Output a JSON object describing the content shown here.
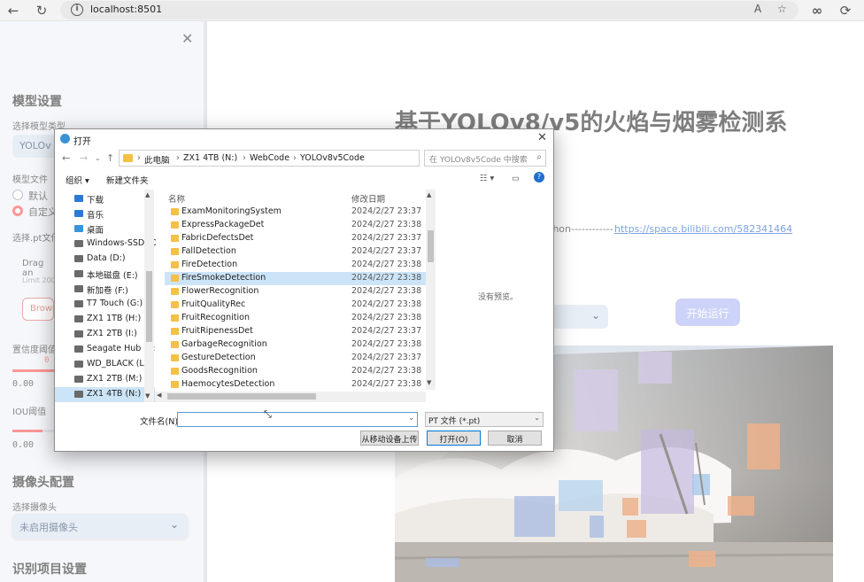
{
  "browser": {
    "url": "localhost:8501",
    "read_aloud_label": "A",
    "icons": [
      "back-arrow-icon",
      "refresh-icon",
      "info-icon",
      "read-aloud-icon",
      "favorite-star-icon",
      "infinity-icon",
      "extensions-icon"
    ]
  },
  "sidebar": {
    "section_model": "模型设置",
    "model_type_label": "选择模型类型",
    "model_type_value": "YOLOv",
    "model_file_label": "模型文件",
    "radio_default": "默认",
    "radio_custom": "自定义",
    "upload_label": "选择.pt文件",
    "upload_drag": "Drag an",
    "upload_limit": "Limit 200",
    "browse_label": "Brows",
    "conf_label": "置信度阈值",
    "conf_value": "0.00",
    "conf_fraction": 0.37,
    "conf_thumb": "0",
    "iou_label": "IOU阈值",
    "iou_value": "0.00",
    "iou_fraction": 0.17,
    "section_camera": "摄像头配置",
    "camera_label": "选择摄像头",
    "camera_value": "未启用摄像头",
    "section_recognition": "识别项目设置"
  },
  "main": {
    "title": "基于YOLOv8/v5的火焰与烟雾检测系",
    "link_prefix": "thon------------",
    "link_text": "https://space.bilibili.com/582341464",
    "run_button": "开始运行"
  },
  "dialog": {
    "title": "打开",
    "breadcrumbs": [
      "此电脑",
      "ZX1 4TB (N:)",
      "WebCode",
      "YOLOv8v5Code"
    ],
    "search_placeholder": "在 YOLOv8v5Code 中搜索",
    "toolbar_organize": "组织 ▾",
    "toolbar_new_folder": "新建文件夹",
    "nav_items": [
      {
        "label": "下载",
        "icon": "download-icon"
      },
      {
        "label": "音乐",
        "icon": "music-icon"
      },
      {
        "label": "桌面",
        "icon": "desktop-icon"
      },
      {
        "label": "Windows-SSD (C",
        "icon": "drive-icon"
      },
      {
        "label": "Data (D:)",
        "icon": "drive-icon"
      },
      {
        "label": "本地磁盘 (E:)",
        "icon": "drive-icon"
      },
      {
        "label": "新加卷 (F:)",
        "icon": "drive-icon"
      },
      {
        "label": "T7 Touch (G:)",
        "icon": "drive-icon"
      },
      {
        "label": "ZX1 1TB (H:)",
        "icon": "drive-icon"
      },
      {
        "label": "ZX1 2TB (I:)",
        "icon": "drive-icon"
      },
      {
        "label": "Seagate Hub (K:",
        "icon": "drive-icon"
      },
      {
        "label": "WD_BLACK (L:)",
        "icon": "drive-icon"
      },
      {
        "label": "ZX1 2TB (M:)",
        "icon": "drive-icon"
      },
      {
        "label": "ZX1 4TB (N:)",
        "icon": "drive-icon",
        "selected": true
      }
    ],
    "col_name": "名称",
    "col_date": "修改日期",
    "files": [
      {
        "name": "ExamMonitoringSystem",
        "date": "2024/2/27 23:37"
      },
      {
        "name": "ExpressPackageDet",
        "date": "2024/2/27 23:38"
      },
      {
        "name": "FabricDefectsDet",
        "date": "2024/2/27 23:37"
      },
      {
        "name": "FallDetection",
        "date": "2024/2/27 23:37"
      },
      {
        "name": "FireDetection",
        "date": "2024/2/27 23:38"
      },
      {
        "name": "FireSmokeDetection",
        "date": "2024/2/27 23:38",
        "selected": true
      },
      {
        "name": "FlowerRecognition",
        "date": "2024/2/27 23:38"
      },
      {
        "name": "FruitQualityRec",
        "date": "2024/2/27 23:38"
      },
      {
        "name": "FruitRecognition",
        "date": "2024/2/27 23:38"
      },
      {
        "name": "FruitRipenessDet",
        "date": "2024/2/27 23:37"
      },
      {
        "name": "GarbageRecognition",
        "date": "2024/2/27 23:38"
      },
      {
        "name": "GestureDetection",
        "date": "2024/2/27 23:37"
      },
      {
        "name": "GoodsRecognition",
        "date": "2024/2/27 23:38"
      },
      {
        "name": "HaemocytesDetection",
        "date": "2024/2/27 23:38"
      }
    ],
    "no_preview": "没有预览。",
    "filename_label": "文件名(N):",
    "filename_value": "",
    "filetype_value": "PT 文件 (*.pt)",
    "btn_mobile": "从移动设备上传",
    "btn_open": "打开(O)",
    "btn_cancel": "取消"
  }
}
